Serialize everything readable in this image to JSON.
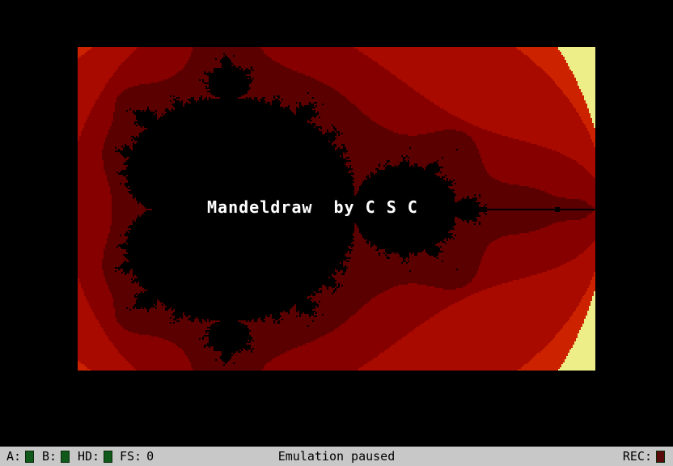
{
  "emulator": {
    "screen": {
      "title_text": "Mandeldraw  by C S C",
      "palette": [
        "#000000",
        "#5a0000",
        "#870000",
        "#a80a00",
        "#cc2200",
        "#eeee88"
      ]
    },
    "statusbar": {
      "drive_a_label": "A:",
      "drive_b_label": "B:",
      "drive_hd_label": "HD:",
      "fs_label": "FS:",
      "fs_value": "0",
      "center_status": "Emulation paused",
      "rec_label": "REC:",
      "led_colors": {
        "drive_idle": "#0f5a1a",
        "rec_idle": "#5a0a0a"
      }
    }
  }
}
